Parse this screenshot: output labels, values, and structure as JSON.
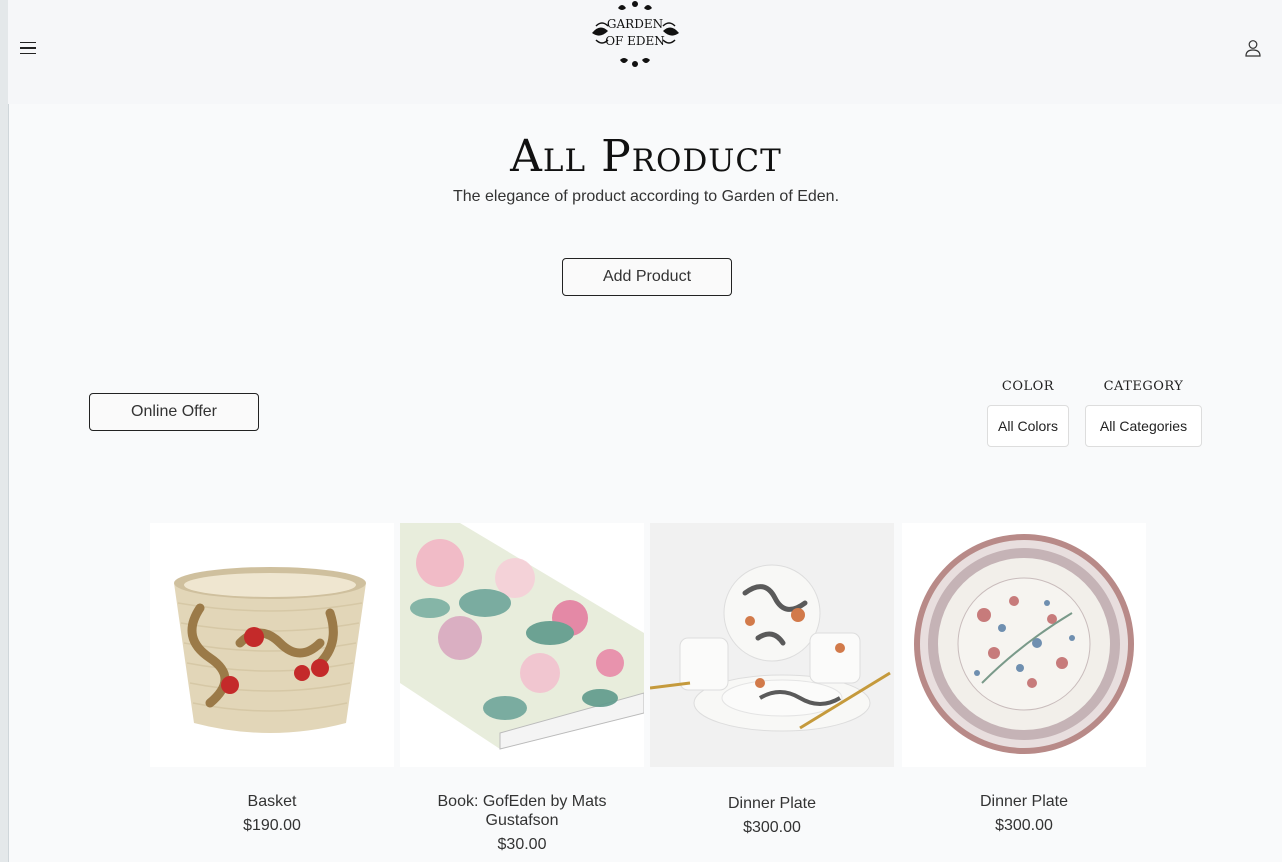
{
  "header": {
    "menu_icon": "hamburger-menu-icon",
    "logo_text_line1": "GARDEN",
    "logo_text_line2": "OF EDEN",
    "user_icon": "user-icon"
  },
  "page": {
    "title": "All Product",
    "subtitle": "The elegance of product according to Garden of Eden.",
    "add_button": "Add Product",
    "offer_button": "Online Offer"
  },
  "filters": {
    "color_label": "COLOR",
    "color_value": "All Colors",
    "category_label": "CATEGORY",
    "category_value": "All Categories"
  },
  "products": [
    {
      "name": "Basket",
      "price": "$190.00"
    },
    {
      "name": "Book: GofEden by Mats Gustafson",
      "price": "$30.00"
    },
    {
      "name": "Dinner Plate",
      "price": "$300.00"
    },
    {
      "name": "Dinner Plate",
      "price": "$300.00"
    }
  ],
  "colors": {
    "background": "#f9fafb",
    "text": "#222222",
    "button_border": "#222222"
  }
}
